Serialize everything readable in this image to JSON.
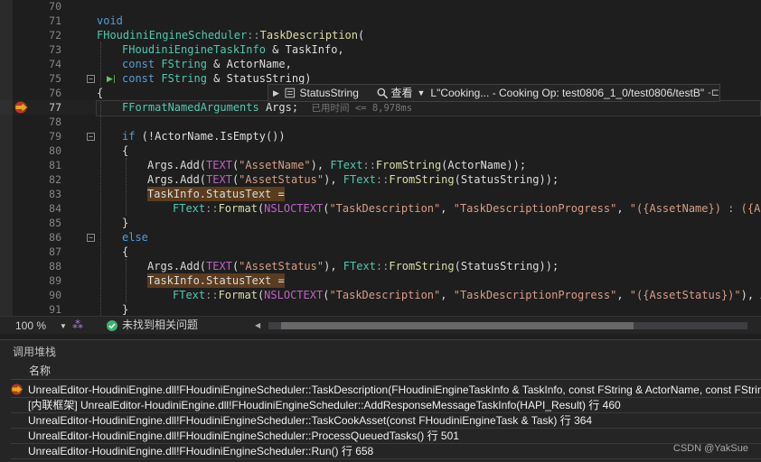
{
  "editor": {
    "lines": [
      {
        "n": "70"
      },
      {
        "n": "71"
      },
      {
        "n": "72"
      },
      {
        "n": "73"
      },
      {
        "n": "74"
      },
      {
        "n": "75"
      },
      {
        "n": "76"
      },
      {
        "n": "77"
      },
      {
        "n": "78"
      },
      {
        "n": "79"
      },
      {
        "n": "80"
      },
      {
        "n": "81"
      },
      {
        "n": "82"
      },
      {
        "n": "83"
      },
      {
        "n": "84"
      },
      {
        "n": "85"
      },
      {
        "n": "86"
      },
      {
        "n": "87"
      },
      {
        "n": "88"
      },
      {
        "n": "89"
      },
      {
        "n": "90"
      },
      {
        "n": "91"
      }
    ],
    "code": {
      "l71_void": "void",
      "l72_class": "FHoudiniEngineScheduler",
      "l72_sep": "::",
      "l72_fn": "TaskDescription",
      "l72_paren": "(",
      "l73_type": "FHoudiniEngineTaskInfo",
      "l73_rest": " & TaskInfo,",
      "l74_const": "const",
      "l74_type": "FString",
      "l74_rest": " & ActorName,",
      "l75_const": "const",
      "l75_type": "FString",
      "l75_rest": " & StatusString)",
      "l76": "{",
      "l77_type": "FFormatNamedArguments",
      "l77_rest": " Args;",
      "l77_hint": "已用时间 <= 8,978ms",
      "l79_if": "if",
      "l79_rest": " (!ActorName.IsEmpty())",
      "l80": "{",
      "l81_a": "Args.Add(",
      "l81_macro": "TEXT",
      "l81_str": "\"AssetName\"",
      "l81_b": "), ",
      "l81_type": "FText",
      "l81_sep": "::",
      "l81_fn": "FromString",
      "l81_c": "(ActorName));",
      "l82_a": "Args.Add(",
      "l82_macro": "TEXT",
      "l82_str": "\"AssetStatus\"",
      "l82_b": "), ",
      "l82_type": "FText",
      "l82_sep": "::",
      "l82_fn": "FromString",
      "l82_c": "(StatusString));",
      "l83": "TaskInfo.StatusText =",
      "l84_type": "FText",
      "l84_sep": "::",
      "l84_fn": "Format",
      "l84_a": "(",
      "l84_macro": "NSLOCTEXT",
      "l84_b": "(",
      "l84_s1": "\"TaskDescription\"",
      "l84_c": ", ",
      "l84_s2": "\"TaskDescriptionProgress\"",
      "l84_d": ", ",
      "l84_s3": "\"({AssetName}) : ({Asse",
      "l85": "}",
      "l86_else": "else",
      "l87": "{",
      "l88_a": "Args.Add(",
      "l88_macro": "TEXT",
      "l88_str": "\"AssetStatus\"",
      "l88_b": "), ",
      "l88_type": "FText",
      "l88_sep": "::",
      "l88_fn": "FromString",
      "l88_c": "(StatusString));",
      "l89": "TaskInfo.StatusText =",
      "l90_type": "FText",
      "l90_sep": "::",
      "l90_fn": "Format",
      "l90_a": "(",
      "l90_macro": "NSLOCTEXT",
      "l90_b": "(",
      "l90_s1": "\"TaskDescription\"",
      "l90_c": ", ",
      "l90_s2": "\"TaskDescriptionProgress\"",
      "l90_d": ", ",
      "l90_s3": "\"({AssetStatus})\"",
      "l90_e": "), Arg",
      "l91": "}"
    }
  },
  "datatip": {
    "var_name": "StatusString",
    "view_label": "查看",
    "value": "L\"Cooking... - Cooking Op:  test0806_1_0/test0806/testB\""
  },
  "footer": {
    "zoom": "100 %",
    "status": "未找到相关问题"
  },
  "callstack": {
    "title": "调用堆栈",
    "column_name": "名称",
    "rows": [
      {
        "text": "UnrealEditor-HoudiniEngine.dll!FHoudiniEngineScheduler::TaskDescription(FHoudiniEngineTaskInfo & TaskInfo, const FString & ActorName, const FString"
      },
      {
        "text": "[内联框架] UnrealEditor-HoudiniEngine.dll!FHoudiniEngineScheduler::AddResponseMessageTaskInfo(HAPI_Result) 行 460"
      },
      {
        "text": "UnrealEditor-HoudiniEngine.dll!FHoudiniEngineScheduler::TaskCookAsset(const FHoudiniEngineTask & Task) 行 364"
      },
      {
        "text": "UnrealEditor-HoudiniEngine.dll!FHoudiniEngineScheduler::ProcessQueuedTasks() 行 501"
      },
      {
        "text": "UnrealEditor-HoudiniEngine.dll!FHoudiniEngineScheduler::Run() 行 658"
      }
    ]
  },
  "watermark": "CSDN @YakSue",
  "colors": {
    "background": "#1e1e1e",
    "keyword": "#569cd6",
    "type": "#4ec9b0",
    "function": "#dcdcaa",
    "string": "#d69d85",
    "breakpoint_arrow": "#f0a020"
  }
}
